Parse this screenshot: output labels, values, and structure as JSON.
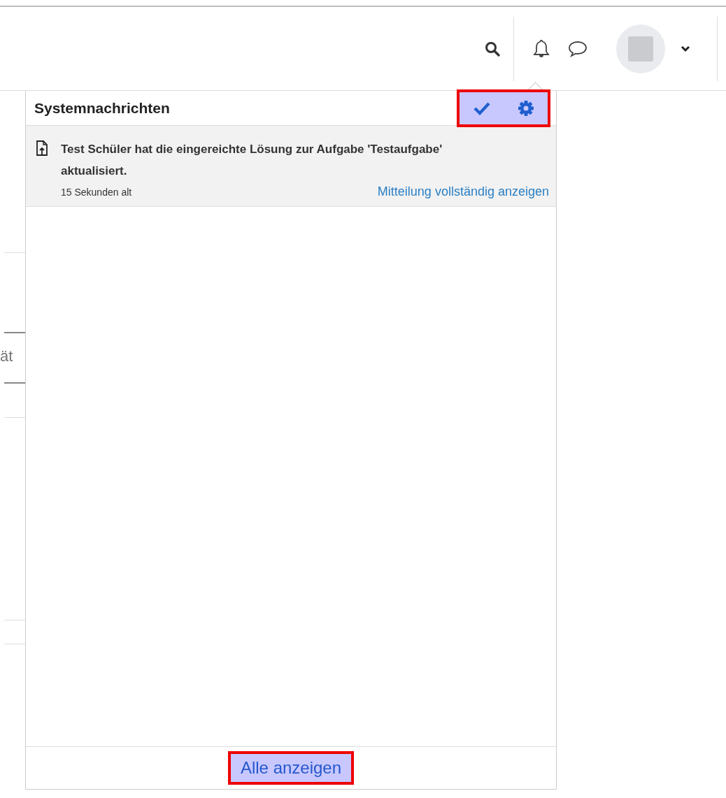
{
  "left_fragment": {
    "text": "ät"
  },
  "navbar": {
    "avatar": {
      "kind": "placeholder"
    }
  },
  "panel": {
    "title": "Systemnachrichten",
    "actions": [
      {
        "kind": "mark-read",
        "highlighted": true
      },
      {
        "kind": "settings",
        "highlighted": true
      }
    ],
    "notifications": [
      {
        "kind": "file-upload",
        "message": "Test Schüler hat die eingereichte Lösung zur Aufgabe 'Testaufgabe' aktualisiert.",
        "time": "15 Sekunden alt",
        "link": "Mitteilung vollständig anzeigen",
        "read": false
      }
    ],
    "footer": {
      "label": "Alle anzeigen",
      "highlighted": true
    }
  }
}
